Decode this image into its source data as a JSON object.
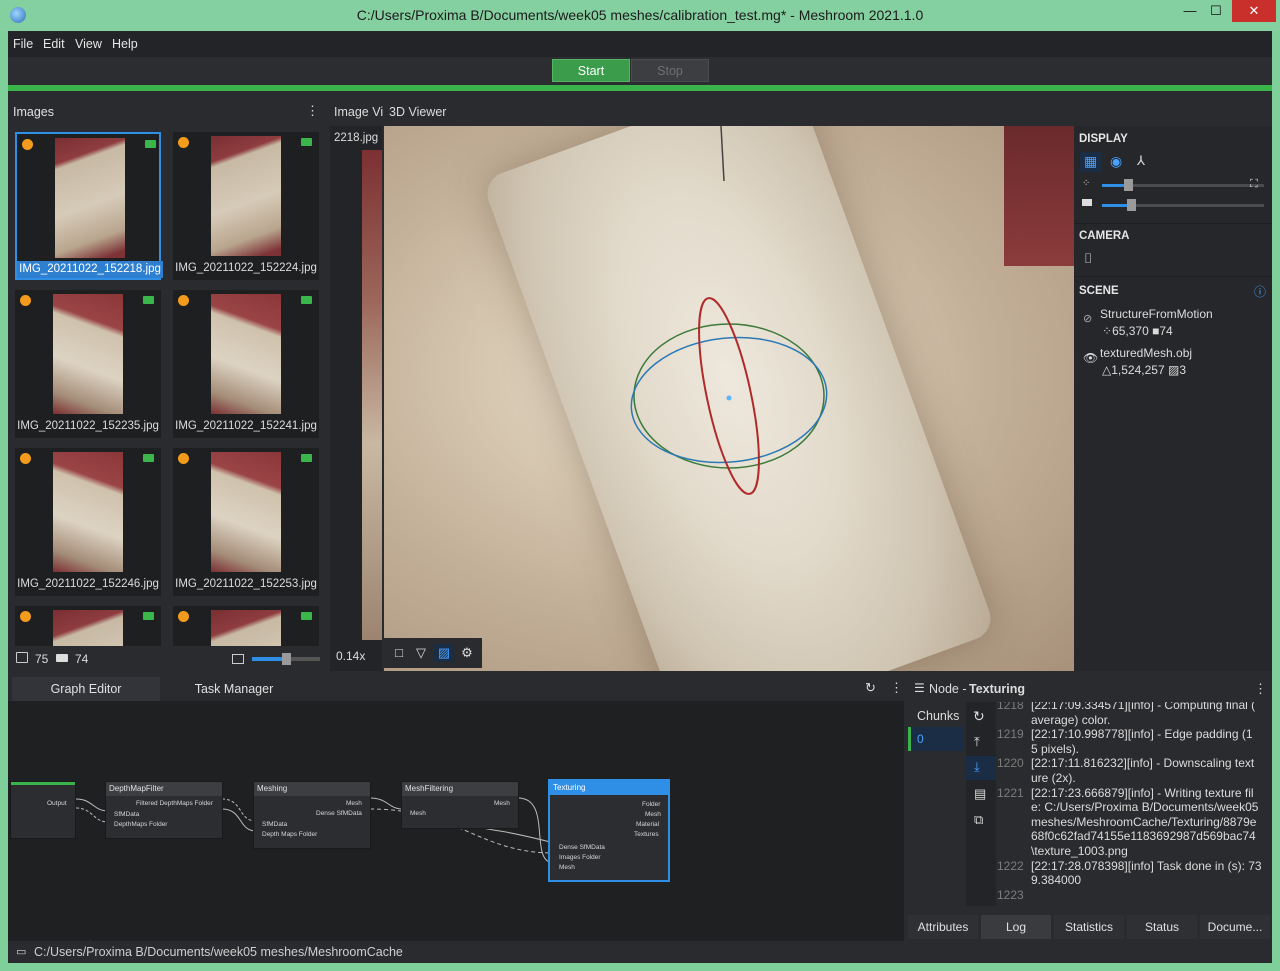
{
  "window": {
    "title": "C:/Users/Proxima B/Documents/week05 meshes/calibration_test.mg* - Meshroom 2021.1.0",
    "minimize": "—",
    "maximize": "☐",
    "close": "✕"
  },
  "menu": [
    "File",
    "Edit",
    "View",
    "Help"
  ],
  "run": {
    "start": "Start",
    "stop": "Stop"
  },
  "images_panel": {
    "title": "Images",
    "thumbnails": [
      {
        "name": "IMG_20211022_152218.jpg"
      },
      {
        "name": "IMG_20211022_152224.jpg"
      },
      {
        "name": "IMG_20211022_152235.jpg"
      },
      {
        "name": "IMG_20211022_152241.jpg"
      },
      {
        "name": "IMG_20211022_152246.jpg"
      },
      {
        "name": "IMG_20211022_152253.jpg"
      }
    ],
    "image_count": "75",
    "camera_count": "74"
  },
  "viewer": {
    "image_tab": "Image Vi",
    "viewer3d_tab": "3D Viewer",
    "image_name": "2218.jpg",
    "zoom": "0.14x"
  },
  "settings": {
    "display": "DISPLAY",
    "camera": "CAMERA",
    "scene": "SCENE",
    "display_slider1": 0.15,
    "display_slider2": 0.18,
    "scene_items": [
      {
        "name": "StructureFromMotion",
        "points": "65,370",
        "cameras": "74"
      },
      {
        "name": "texturedMesh.obj",
        "triangles": "1,524,257",
        "textures": "3"
      }
    ]
  },
  "graph": {
    "tabs": [
      "Graph Editor",
      "Task Manager"
    ],
    "nodes": {
      "depthmapfilter": {
        "title": "DepthMapFilter",
        "out": "Filtered DepthMaps Folder",
        "in1": "SfMData",
        "in2": "DepthMaps Folder"
      },
      "meshing": {
        "title": "Meshing",
        "out1": "Mesh",
        "out2": "Dense SfMData",
        "in1": "SfMData",
        "in2": "Depth Maps Folder"
      },
      "meshfiltering": {
        "title": "MeshFiltering",
        "out": "Mesh",
        "in": "Mesh"
      },
      "texturing": {
        "title": "Texturing",
        "out1": "Folder",
        "out2": "Mesh",
        "out3": "Material",
        "out4": "Textures",
        "in1": "Dense SfMData",
        "in2": "Images Folder",
        "in3": "Mesh"
      },
      "left": {
        "out": "Output"
      }
    }
  },
  "node_panel": {
    "label": "Node - ",
    "node_name": "Texturing",
    "chunks_label": "Chunks",
    "chunk": "0",
    "log": [
      {
        "num": "1218",
        "text": "[22:17:09.334571][info] - Computing final ("
      },
      {
        "num": "",
        "text": "average) color."
      },
      {
        "num": "1219",
        "text": "[22:17:10.998778][info]  - Edge padding (1"
      },
      {
        "num": "",
        "text": "5 pixels)."
      },
      {
        "num": "1220",
        "text": "[22:17:11.816232][info]  - Downscaling text"
      },
      {
        "num": "",
        "text": "ure (2x)."
      },
      {
        "num": "1221",
        "text": "[22:17:23.666879][info]  - Writing texture fil"
      },
      {
        "num": "",
        "text": "e: C:/Users/Proxima B/Documents/week05"
      },
      {
        "num": "",
        "text": "meshes/MeshroomCache/Texturing/8879e"
      },
      {
        "num": "",
        "text": "68f0c62fad74155e1183692987d569bac74"
      },
      {
        "num": "",
        "text": "\\texture_1003.png"
      },
      {
        "num": "1222",
        "text": "[22:17:28.078398][info] Task done in (s): 73"
      },
      {
        "num": "",
        "text": "9.384000"
      },
      {
        "num": "1223",
        "text": ""
      }
    ],
    "tabs": [
      "Attributes",
      "Log",
      "Statistics",
      "Status",
      "Docume..."
    ]
  },
  "statusbar": {
    "path": "C:/Users/Proxima B/Documents/week05 meshes/MeshroomCache"
  },
  "colors": {
    "accent": "#2f8ee6",
    "run": "#3ab44a",
    "orange": "#f29b1c"
  }
}
